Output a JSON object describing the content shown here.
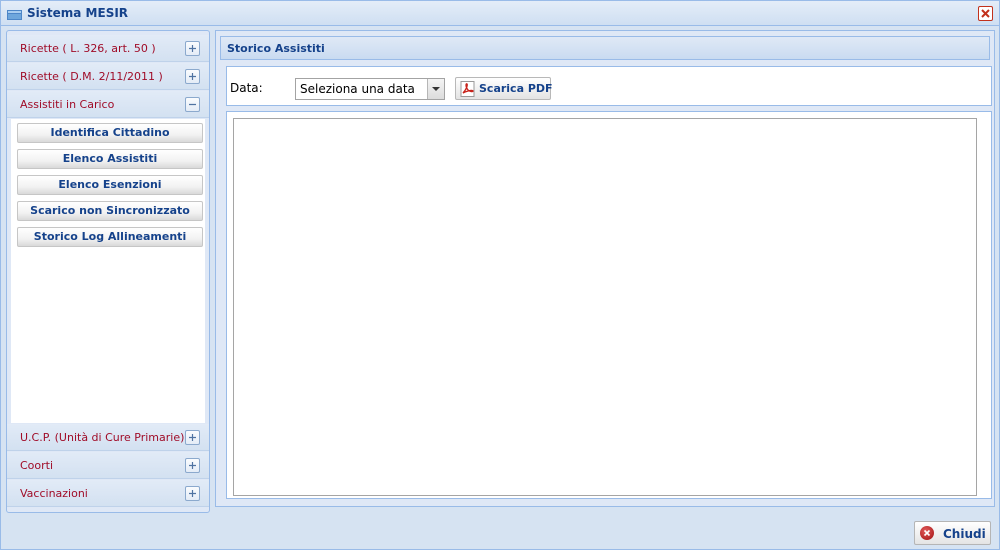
{
  "window": {
    "title": "Sistema MESIR",
    "app_icon": "window-icon",
    "close_icon": "close-icon"
  },
  "sidebar": {
    "sections": [
      {
        "label": "Ricette ( L. 326, art. 50 )",
        "state": "collapsed",
        "toggle_icon": "plus-icon"
      },
      {
        "label": "Ricette ( D.M. 2/11/2011 )",
        "state": "collapsed",
        "toggle_icon": "plus-icon"
      },
      {
        "label": "Assistiti in Carico",
        "state": "expanded",
        "toggle_icon": "minus-icon"
      },
      {
        "label": "U.C.P. (Unità di Cure Primarie)",
        "state": "collapsed",
        "toggle_icon": "plus-icon"
      },
      {
        "label": "Coorti",
        "state": "collapsed",
        "toggle_icon": "plus-icon"
      },
      {
        "label": "Vaccinazioni",
        "state": "collapsed",
        "toggle_icon": "plus-icon"
      }
    ],
    "buttons": [
      {
        "label": "Identifica Cittadino"
      },
      {
        "label": "Elenco Assistiti"
      },
      {
        "label": "Elenco Esenzioni"
      },
      {
        "label": "Scarico non Sincronizzato"
      },
      {
        "label": "Storico Log Allineamenti"
      }
    ]
  },
  "panel": {
    "title": "Storico Assistiti",
    "date_label": "Data:",
    "date_select": {
      "value": "Seleziona una data",
      "icon": "chevron-down-icon"
    },
    "pdf_button": {
      "label": "Scarica PDF",
      "icon": "pdf-icon"
    }
  },
  "footer": {
    "close_button": {
      "label": "Chiudi",
      "icon": "close-circle-icon"
    }
  },
  "colors": {
    "accent": "#15428b",
    "section_label": "#a00c28",
    "border": "#99bbe8",
    "background": "#dfe8f6"
  }
}
